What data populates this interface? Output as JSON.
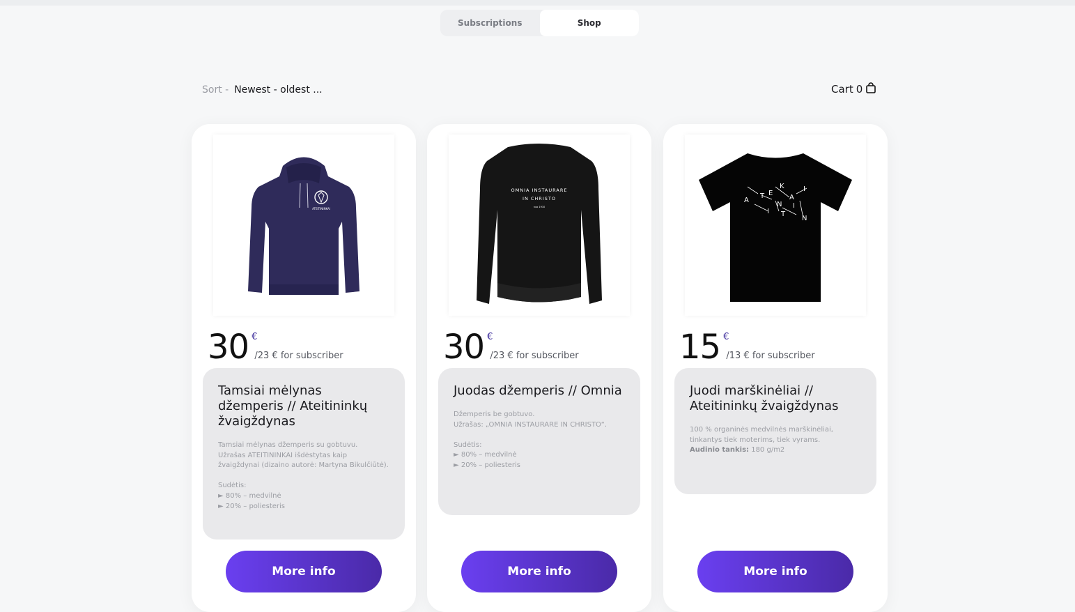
{
  "tabs": [
    {
      "label": "Subscriptions",
      "active": false
    },
    {
      "label": "Shop",
      "active": true
    }
  ],
  "sort": {
    "label": "Sort -",
    "value": "Newest - oldest ..."
  },
  "cart": {
    "label": "Cart",
    "count": "0",
    "icon": "shopping-bag-icon"
  },
  "products": [
    {
      "image": "navy-hoodie",
      "print_text": "ATEITININKAI",
      "price": "30",
      "currency": "€",
      "subscriber_price": "/23 € for subscriber",
      "title": "Tamsiai mėlynas džemperis // Ateitininkų žvaigždynas",
      "description": "Tamsiai mėlynas džemperis su gobtuvu.\nUžrašas ATEITININKAI išdėstytas kaip žvaigždynai (dizaino autorė: Martyna Bikulčiūtė).\n\nSudėtis:\n► 80% – medvilnė\n► 20% – poliesteris",
      "button": "More info"
    },
    {
      "image": "black-sweatshirt",
      "print_line1": "OMNIA INSTAURARE",
      "print_line2": "IN CHRISTO",
      "print_line3": "nuo 1910",
      "price": "30",
      "currency": "€",
      "subscriber_price": "/23 € for subscriber",
      "title": "Juodas džemperis // Omnia",
      "description": "Džemperis be gobtuvo.\nUžrašas: „OMNIA INSTAURARE IN CHRISTO“.\n\nSudėtis:\n► 80% – medvilnė\n► 20% – poliesteris",
      "button": "More info"
    },
    {
      "image": "black-tshirt",
      "price": "15",
      "currency": "€",
      "subscriber_price": "/13 € for subscriber",
      "title": "Juodi marškinėliai // Ateitininkų žvaigždynas",
      "description": "100 % organinės medvilnės marškinėliai, tinkantys tiek moterims, tiek vyrams.\n",
      "density_label": "Audinio tankis:",
      "density_value": " 180 g/m2",
      "button": "More info"
    }
  ],
  "colors": {
    "accent_start": "#6a3ff0",
    "accent_end": "#4a2aa8",
    "currency": "#3a2a9a"
  }
}
